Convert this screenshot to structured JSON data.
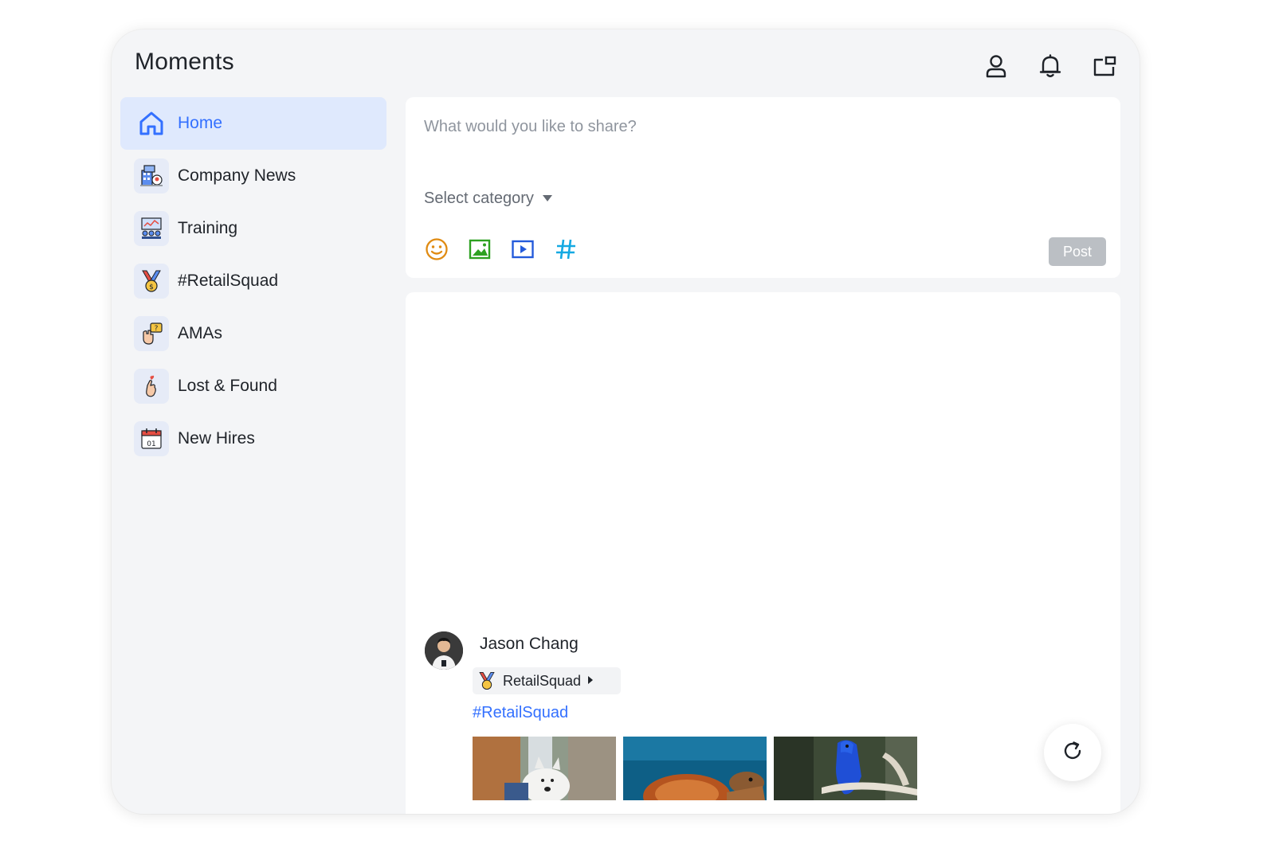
{
  "app": {
    "title": "Moments"
  },
  "header_icons": [
    "profile-icon",
    "bell-icon",
    "new-window-icon"
  ],
  "sidebar": {
    "items": [
      {
        "label": "Home",
        "icon": "home-icon",
        "active": true
      },
      {
        "label": "Company News",
        "icon": "company-building-icon",
        "active": false
      },
      {
        "label": "Training",
        "icon": "training-board-icon",
        "active": false
      },
      {
        "label": "#RetailSquad",
        "icon": "medal-icon",
        "active": false
      },
      {
        "label": "AMAs",
        "icon": "raised-hand-question-icon",
        "active": false
      },
      {
        "label": "Lost & Found",
        "icon": "finger-heart-icon",
        "active": false
      },
      {
        "label": "New Hires",
        "icon": "calendar-icon",
        "active": false
      }
    ]
  },
  "composer": {
    "placeholder": "What would you like to share?",
    "category_label": "Select category",
    "tools": [
      "emoji-icon",
      "image-icon",
      "video-icon",
      "hashtag-icon"
    ],
    "post_label": "Post"
  },
  "feed": {
    "post": {
      "author": "Jason Chang",
      "channel": "RetailSquad",
      "hashtag": "#RetailSquad",
      "photos": [
        "dog-photo",
        "sea-turtle-photo",
        "blue-parrot-photo"
      ]
    }
  },
  "colors": {
    "accent": "#3370ff",
    "active_bg": "#dfe9fd",
    "window_bg": "#f4f5f7",
    "post_button_disabled": "#bbbfc4",
    "emoji_tool": "#e08b12",
    "image_tool": "#2ea121",
    "video_tool": "#245bdb",
    "hashtag_tool": "#14a9e2"
  }
}
